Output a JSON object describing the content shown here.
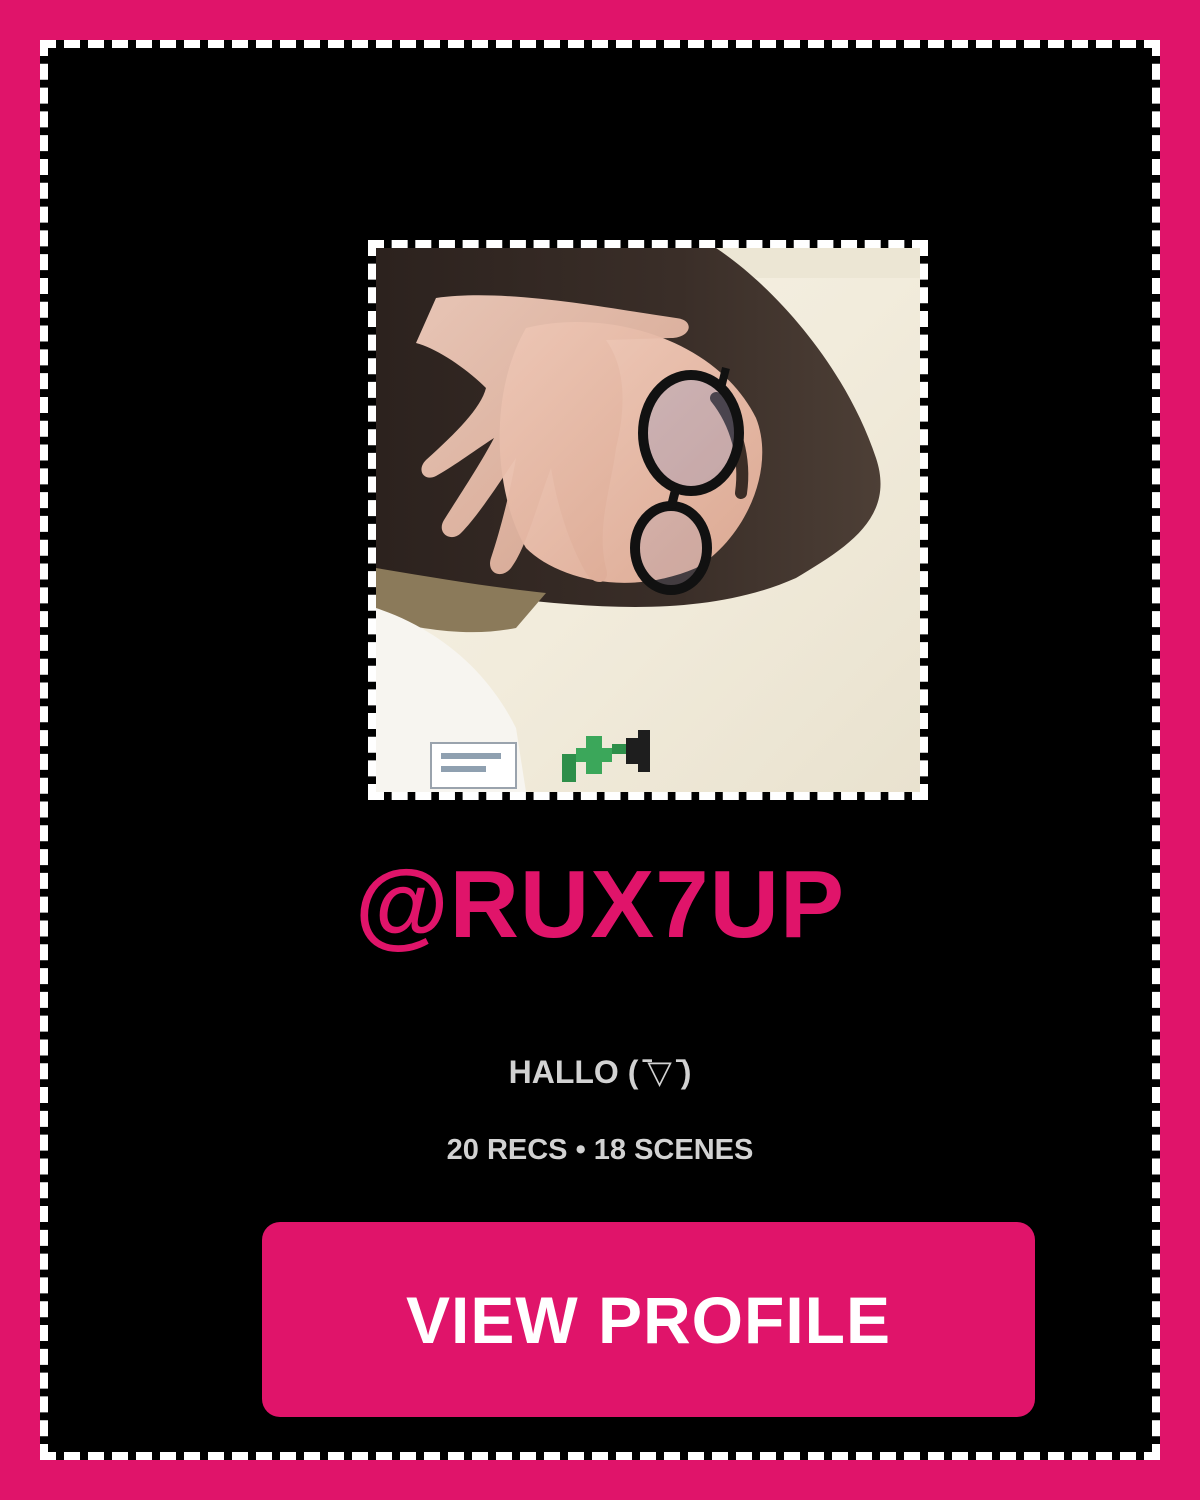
{
  "colors": {
    "accent": "#e0146a",
    "background": "#000000",
    "text_secondary": "#d2d2d2",
    "button_text": "#ffffff"
  },
  "profile": {
    "username": "@RUX7UP",
    "bio": "HALLO ( ̄▽ ̄)",
    "stats": "20 RECS • 18 SCENES"
  },
  "actions": {
    "view_profile_label": "VIEW PROFILE"
  }
}
